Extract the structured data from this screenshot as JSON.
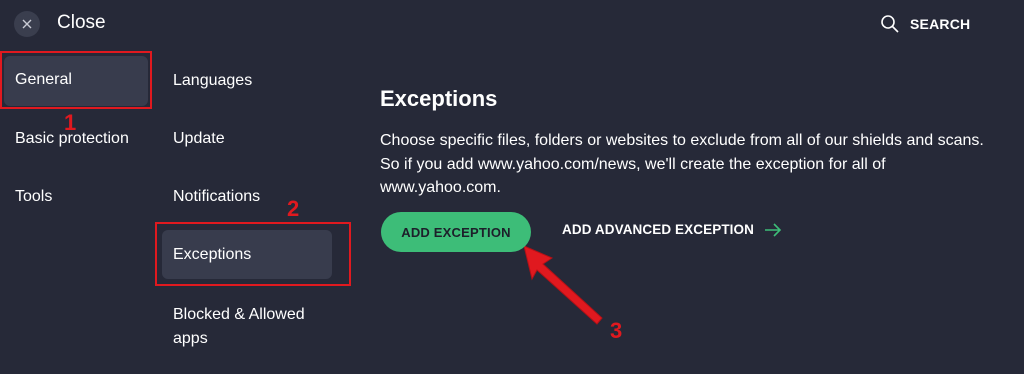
{
  "header": {
    "close_label": "Close",
    "search_label": "SEARCH"
  },
  "nav_primary": [
    {
      "label": "General"
    },
    {
      "label": "Basic protection"
    },
    {
      "label": "Tools"
    }
  ],
  "nav_secondary": [
    {
      "label": "Languages"
    },
    {
      "label": "Update"
    },
    {
      "label": "Notifications"
    },
    {
      "label": "Exceptions"
    },
    {
      "label": "Blocked & Allowed apps"
    }
  ],
  "content": {
    "heading": "Exceptions",
    "description": "Choose specific files, folders or websites to exclude from all of our shields and scans. So if you add www.yahoo.com/news, we'll create the exception for all of www.yahoo.com.",
    "add_exception_label": "ADD EXCEPTION",
    "add_advanced_label": "ADD ADVANCED EXCEPTION"
  },
  "annotations": {
    "marker_1": "1",
    "marker_2": "2",
    "marker_3": "3"
  },
  "colors": {
    "background": "#262938",
    "selected": "#383c4d",
    "accent_green": "#3dbd78",
    "annotation_red": "#e0191f"
  },
  "icons": {
    "close": "close-icon",
    "search": "search-icon",
    "arrow": "arrow-right-icon"
  }
}
